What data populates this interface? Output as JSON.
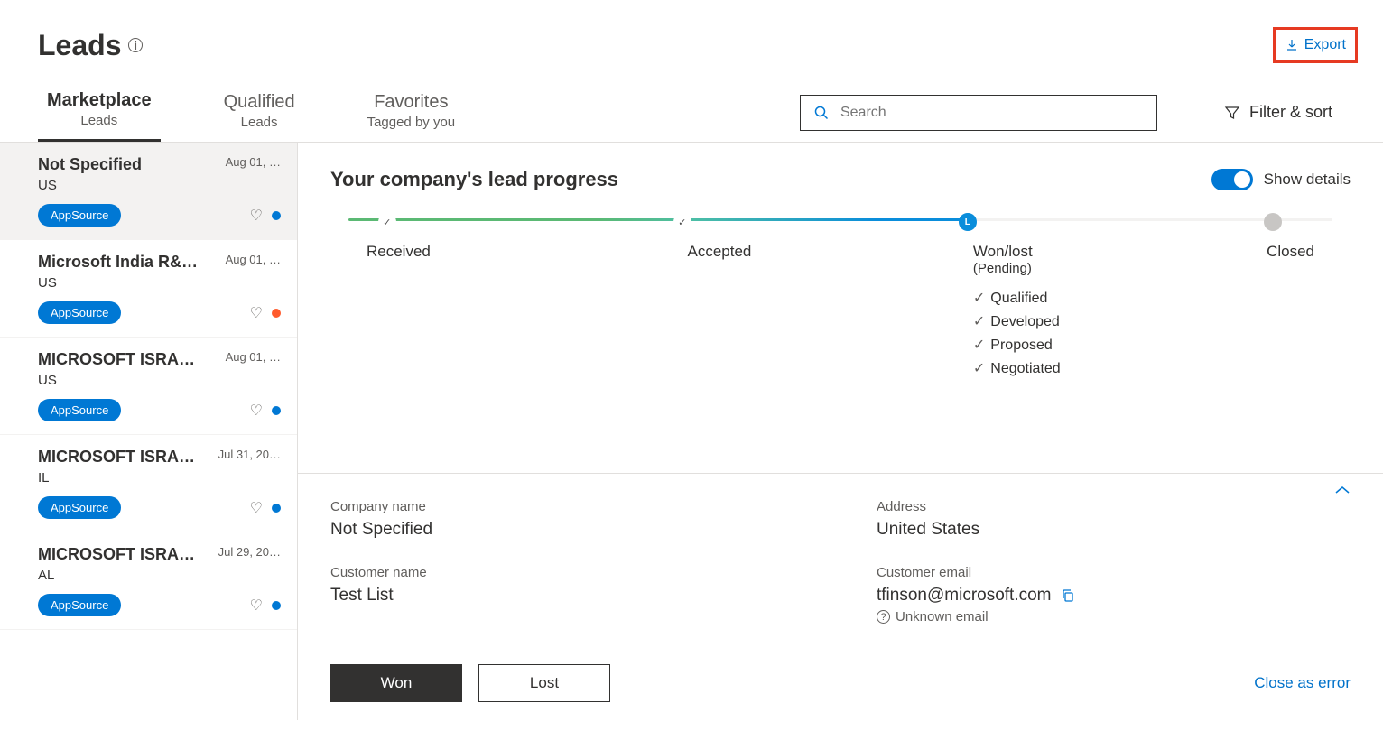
{
  "header": {
    "title": "Leads",
    "export": "Export"
  },
  "tabs": [
    {
      "title": "Marketplace",
      "sub": "Leads",
      "active": true
    },
    {
      "title": "Qualified",
      "sub": "Leads",
      "active": false
    },
    {
      "title": "Favorites",
      "sub": "Tagged by you",
      "active": false
    }
  ],
  "search": {
    "placeholder": "Search"
  },
  "filter_sort": "Filter & sort",
  "leads": [
    {
      "name": "Not Specified",
      "date": "Aug 01, …",
      "loc": "US",
      "badge": "AppSource",
      "dot": "blue",
      "selected": true
    },
    {
      "name": "Microsoft India R&…",
      "date": "Aug 01, …",
      "loc": "US",
      "badge": "AppSource",
      "dot": "orange"
    },
    {
      "name": "MICROSOFT ISRAE…",
      "date": "Aug 01, …",
      "loc": "US",
      "badge": "AppSource",
      "dot": "blue"
    },
    {
      "name": "MICROSOFT ISRAE…",
      "date": "Jul 31, 20…",
      "loc": "IL",
      "badge": "AppSource",
      "dot": "blue"
    },
    {
      "name": "MICROSOFT ISRAE…",
      "date": "Jul 29, 20…",
      "loc": "AL",
      "badge": "AppSource",
      "dot": "blue"
    }
  ],
  "progress": {
    "title": "Your company's lead progress",
    "show_details": "Show details",
    "stages": {
      "received": "Received",
      "accepted": "Accepted",
      "wonlost": "Won/lost",
      "wonlost_sub": "(Pending)",
      "closed": "Closed"
    },
    "sub_stages": [
      "Qualified",
      "Developed",
      "Proposed",
      "Negotiated"
    ]
  },
  "details": {
    "company_label": "Company name",
    "company_value": "Not Specified",
    "address_label": "Address",
    "address_value": "United States",
    "customer_label": "Customer name",
    "customer_value": "Test List",
    "email_label": "Customer email",
    "email_value": "tfinson@microsoft.com",
    "email_note": "Unknown email"
  },
  "footer": {
    "won": "Won",
    "lost": "Lost",
    "close_error": "Close as error"
  }
}
